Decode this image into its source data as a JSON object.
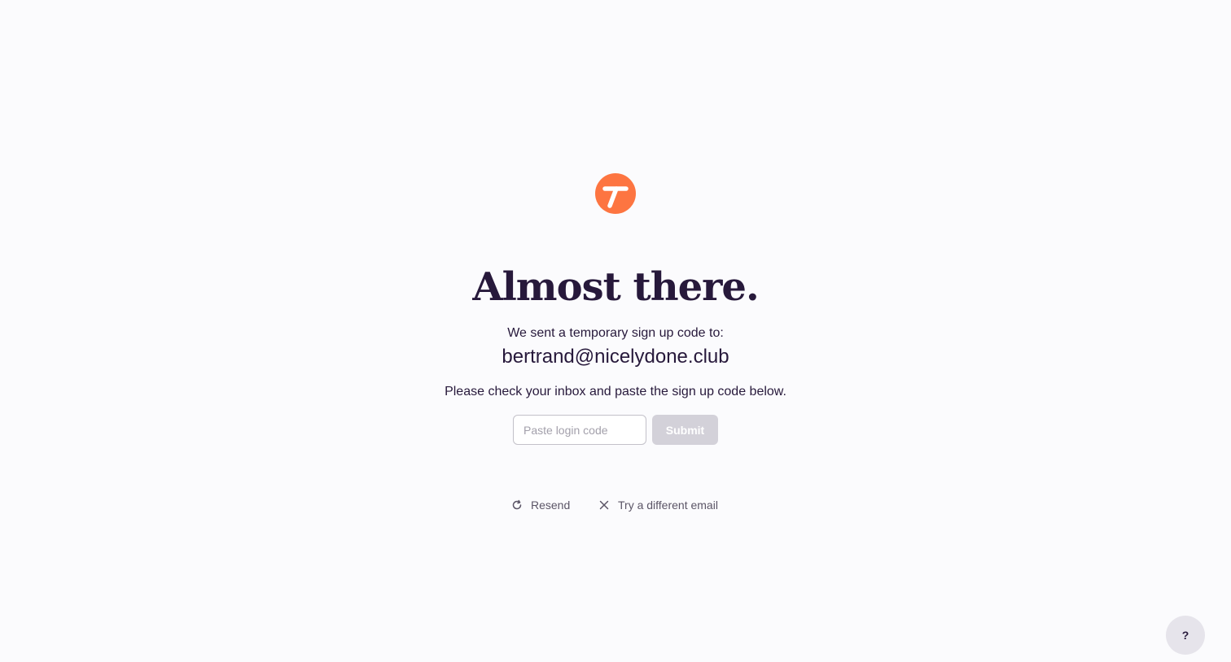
{
  "brand": {
    "logo_icon": "toggl-logo-icon",
    "accent_color": "#fd7541"
  },
  "main": {
    "title": "Almost there.",
    "sent_text": "We sent a temporary sign up code to:",
    "email": "bertrand@nicelydone.club",
    "instructions": "Please check your inbox and paste the sign up code below.",
    "code_input": {
      "value": "",
      "placeholder": "Paste login code"
    },
    "submit_label": "Submit"
  },
  "actions": {
    "resend": {
      "label": "Resend",
      "icon": "refresh-icon"
    },
    "different_email": {
      "label": "Try a different email",
      "icon": "close-icon"
    }
  },
  "help": {
    "label": "?"
  }
}
